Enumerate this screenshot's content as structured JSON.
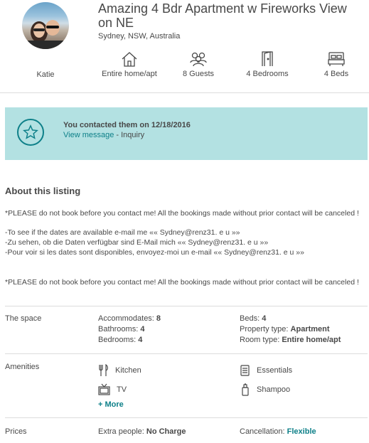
{
  "host": {
    "name": "Katie"
  },
  "listing": {
    "title": "Amazing 4 Bdr Apartment w Fireworks View on NE",
    "location": "Sydney, NSW, Australia"
  },
  "stats": [
    {
      "label": "Entire home/apt",
      "icon": "house-icon"
    },
    {
      "label": "8 Guests",
      "icon": "guests-icon"
    },
    {
      "label": "4 Bedrooms",
      "icon": "door-icon"
    },
    {
      "label": "4 Beds",
      "icon": "bed-icon"
    }
  ],
  "banner": {
    "contacted": "You contacted them on 12/18/2016",
    "view_message": "View message",
    "separator_status": " - Inquiry",
    "icon": "star-icon"
  },
  "about": {
    "heading": "About this listing",
    "p1": "*PLEASE do not book before you contact me! All the bookings made without prior contact will be canceled !",
    "p2_line1": "-To see if the dates are available e-mail me «« Sydney@renz31. e u »»",
    "p2_line2": "-Zu sehen, ob die Daten verfügbar sind E-Mail mich «« Sydney@renz31. e u »»",
    "p2_line3": "-Pour voir si les dates sont disponibles, envoyez-moi un e-mail «« Sydney@renz31. e u »»",
    "p3": "*PLEASE do not book before you contact me! All the bookings made without prior contact will be canceled !"
  },
  "space": {
    "label": "The space",
    "accommodates_label": "Accommodates: ",
    "accommodates_value": "8",
    "bathrooms_label": "Bathrooms: ",
    "bathrooms_value": "4",
    "bedrooms_label": "Bedrooms: ",
    "bedrooms_value": "4",
    "beds_label": "Beds: ",
    "beds_value": "4",
    "property_label": "Property type: ",
    "property_value": "Apartment",
    "room_label": "Room type: ",
    "room_value": "Entire home/apt"
  },
  "amenities": {
    "label": "Amenities",
    "items": [
      {
        "label": "Kitchen",
        "icon": "kitchen-icon"
      },
      {
        "label": "Essentials",
        "icon": "essentials-icon"
      },
      {
        "label": "TV",
        "icon": "tv-icon"
      },
      {
        "label": "Shampoo",
        "icon": "shampoo-icon"
      }
    ],
    "more": "+ More"
  },
  "prices": {
    "label": "Prices",
    "extra_label": "Extra people: ",
    "extra_value": "No Charge",
    "cancel_label": "Cancellation: ",
    "cancel_value": "Flexible"
  },
  "colors": {
    "accent": "#0e8089",
    "banner_bg": "#b3e1e2",
    "text": "#484848"
  }
}
